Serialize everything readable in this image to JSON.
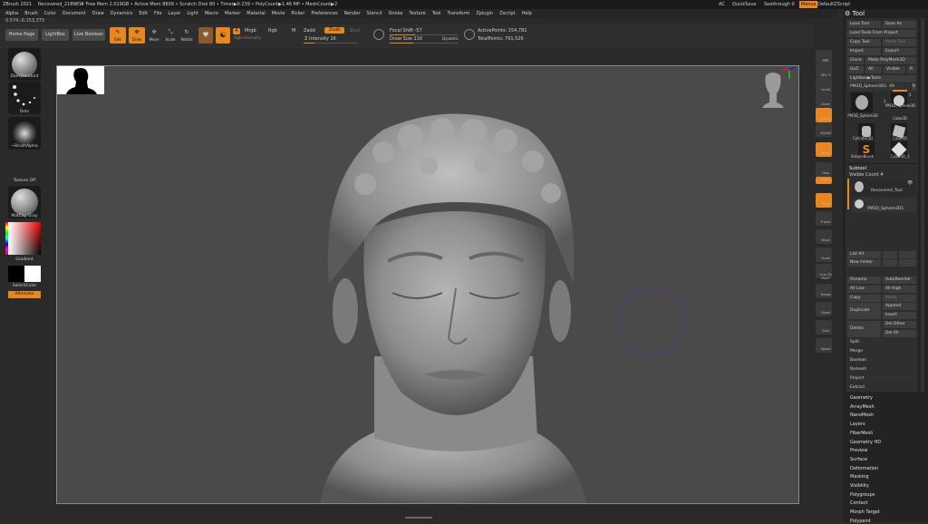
{
  "titlebar": {
    "app": "ZBrush 2021",
    "file": "Recovered_218NEW",
    "stats": "• Free Mem 2.019GB • Active Mem 8809 • Scratch Disk 80 • Timer▶0.239 • PolyCount▶1.46 MP • MeshCount▶2",
    "ac": "AC",
    "quicksave": "QuickSave",
    "seethrough": "Seethrough 0",
    "menus_btn": "Menus",
    "script": "DefaultZScript"
  },
  "menubar": [
    "Alpha",
    "Brush",
    "Color",
    "Document",
    "Draw",
    "Dynamics",
    "Edit",
    "File",
    "Layer",
    "Light",
    "Macro",
    "Marker",
    "Material",
    "Movie",
    "Picker",
    "Preferences",
    "Render",
    "Stencil",
    "Stroke",
    "Texture",
    "Tool",
    "Transform",
    "Zplugin",
    "Zscript",
    "Help"
  ],
  "coords": "0.574,-0.153,375",
  "toolbar": {
    "home": "Home Page",
    "lightbox": "LightBox",
    "liveboolean": "Live Boolean",
    "edit": "Edit",
    "draw": "Draw",
    "move": "Move",
    "scale": "Scale",
    "rotate": "Rotate",
    "a_label": "A",
    "mrgb": "Mrgb",
    "rgb": "Rgb",
    "m": "M",
    "zadd": "Zadd",
    "zsub": "Zsub",
    "zcut": "Zcut",
    "rgb_intensity": "Rgb Intensity",
    "z_intensity": "Z Intensity 16",
    "focal_shift": "Focal Shift -57",
    "draw_size": "Draw Size 116",
    "dynamic": "Dynamic",
    "active_points": "ActivePoints: 154,781",
    "total_points": "TotalPoints: 791,526"
  },
  "leftshelf": {
    "brush": "DamStandard",
    "stroke": "Dots",
    "alpha": "~BrushAlpha",
    "texture": "Texture Off",
    "material": "MatCap Gray",
    "gradient": "Gradient",
    "switch": "SwitchColor",
    "alternate": "Alternate"
  },
  "rightshelf": [
    "BPR",
    "SPix 3",
    "Scroll",
    "Zoom",
    "Actual",
    "AAHalf",
    "Persp",
    "Floor",
    "Local",
    "Gyro",
    "Frame",
    "Move",
    "Scale",
    "Line Fill PolyF",
    "Transp",
    "Ghost",
    "Solo",
    "Xpose"
  ],
  "tool": {
    "title": "Tool",
    "load": "Load Tool",
    "saveas": "Save As",
    "loadproject": "Load Tools From Project",
    "copy": "Copy Tool",
    "paste": "Paste Tool",
    "import": "Import",
    "export": "Export",
    "clone": "Clone",
    "makepoly": "Make PolyMesh3D",
    "goz": "GoZ",
    "all": "All",
    "visible": "Visible",
    "r": "R",
    "lightbox": "Lightbox▶Tools",
    "current": "PM3D_Sphere3D1. 49",
    "thumbs": [
      "PM3D_Sphere3D",
      "PM3D_Sphere3D",
      "Cube3D",
      "Cylinder3D",
      "Cube3D",
      "SimpleBrush",
      "Cube3D_1"
    ],
    "num2": "2",
    "num2b": "2",
    "subtool": "Subtool",
    "visible_count": "Visible Count 4",
    "sub_items": [
      "Recovered_Tool",
      "PM3D_Sphere3D1"
    ],
    "list_all": "List All",
    "new_folder": "New Folder",
    "rename": "Rename",
    "autoreorder": "AutoReorder",
    "all_low": "All Low",
    "all_high": "All High",
    "copy2": "Copy",
    "paste2": "Paste",
    "duplicate": "Duplicate",
    "append": "Append",
    "insert": "Insert",
    "delete": "Delete",
    "del_other": "Del Other",
    "del_all": "Del All",
    "split": "Split",
    "merge": "Merge",
    "boolean": "Boolean",
    "remesh": "Remesh",
    "project": "Project",
    "extract": "Extract"
  },
  "subpalettes": [
    "Geometry",
    "ArrayMesh",
    "NanoMesh",
    "Layers",
    "FiberMesh",
    "Geometry HD",
    "Preview",
    "Surface",
    "Deformation",
    "Masking",
    "Visibility",
    "Polygroups",
    "Contact",
    "Morph Target",
    "Polypaint"
  ],
  "colors": {
    "accent": "#e8861f",
    "bg": "#2a2a2a",
    "canvas": "#4a4a4a"
  }
}
